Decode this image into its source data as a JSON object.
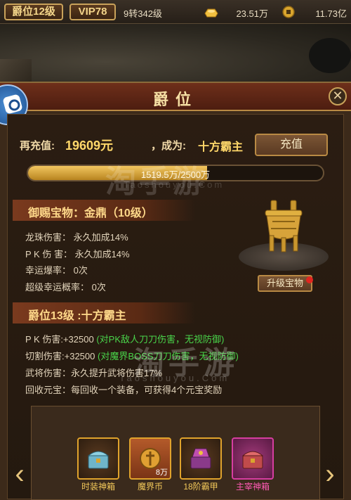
{
  "topbar": {
    "rank_badge": "爵位12级",
    "vip_badge": "VIP78",
    "level_text": "9转342级",
    "gold_value": "23.51万",
    "coin_value": "11.73亿"
  },
  "dialog": {
    "title": "爵位",
    "recharge_label": "再充值:",
    "recharge_amount": "19609元",
    "become_label": "，成为:",
    "target_rank": "十方霸主",
    "recharge_button": "充值",
    "progress_text": "1519.5万/2500万",
    "progress_fraction": 0.608
  },
  "treasure": {
    "header": "御赐宝物：金鼎（10级）",
    "upgrade_button": "升级宝物",
    "attrs": [
      {
        "label": "龙珠伤害：",
        "value": "永久加成14%"
      },
      {
        "label": "P K 伤 害：",
        "value": "永久加成14%"
      },
      {
        "label": "幸运爆率：",
        "value": "0次"
      },
      {
        "label": "超级幸运概率：",
        "value": "0次"
      }
    ]
  },
  "rank": {
    "header": "爵位13级 :十方霸主",
    "attrs": [
      {
        "label": "P K 伤害",
        "value": ":+32500",
        "note": "(对PK敌人刀刀伤害，无视防御)"
      },
      {
        "label": "切割伤害",
        "value": ":+32500",
        "note": "(对魔界BOSS刀刀伤害，无视防御)"
      },
      {
        "label": "武将伤害：",
        "value": "永久提升武将伤害17%",
        "note": ""
      },
      {
        "label": "回收元宝：",
        "value": "每回收一个装备，可获得4个元宝奖励",
        "note": ""
      }
    ]
  },
  "watermark": {
    "cn": "淘手游",
    "en": "Taoshouyou.Com"
  },
  "rewards": [
    {
      "label": "时装神箱",
      "count": "",
      "icon": "chest-icon"
    },
    {
      "label": "魔界币",
      "count": "8万",
      "icon": "coin-icon"
    },
    {
      "label": "18阶霸甲",
      "count": "",
      "icon": "armor-chest-icon"
    },
    {
      "label": "主宰神箱",
      "count": "",
      "icon": "chest-icon"
    }
  ],
  "colors": {
    "gold_text": "#ffd86a",
    "green_text": "#49d44a",
    "reward_label": "#f2c85a",
    "reward_label_pink": "#ff5ab5"
  }
}
